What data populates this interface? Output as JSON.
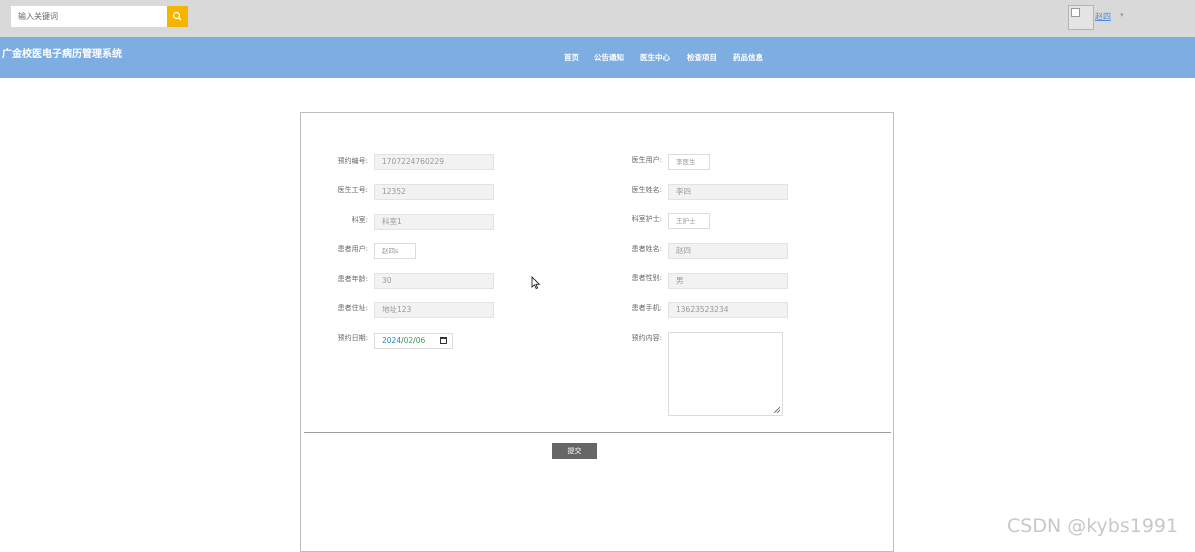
{
  "search": {
    "placeholder": "输入关键词"
  },
  "user": {
    "name": "赵四"
  },
  "site": {
    "title": "广金校医电子病历管理系统"
  },
  "nav": [
    "首页",
    "公告通知",
    "医生中心",
    "检查项目",
    "药品信息"
  ],
  "form": {
    "left": [
      {
        "label": "预约编号:",
        "value": "1707224760229"
      },
      {
        "label": "医生工号:",
        "value": "12352"
      },
      {
        "label": "科室:",
        "value": "科室1"
      },
      {
        "label": "患者用户:",
        "value": "赵四s"
      },
      {
        "label": "患者年龄:",
        "value": "30"
      },
      {
        "label": "患者住址:",
        "value": "地址123"
      }
    ],
    "right": [
      {
        "label": "医生用户:",
        "value": "李医生"
      },
      {
        "label": "医生姓名:",
        "value": "李四"
      },
      {
        "label": "科室护士:",
        "value": "王护士"
      },
      {
        "label": "患者姓名:",
        "value": "赵四"
      },
      {
        "label": "患者性别:",
        "value": "男"
      },
      {
        "label": "患者手机:",
        "value": "13623523234"
      }
    ],
    "date": {
      "label": "预约日期:",
      "year": "2024",
      "month": "02",
      "day": "06"
    },
    "content": {
      "label": "预约内容:",
      "value": ""
    },
    "submit_label": "提交"
  },
  "watermark": "CSDN @kybs1991"
}
